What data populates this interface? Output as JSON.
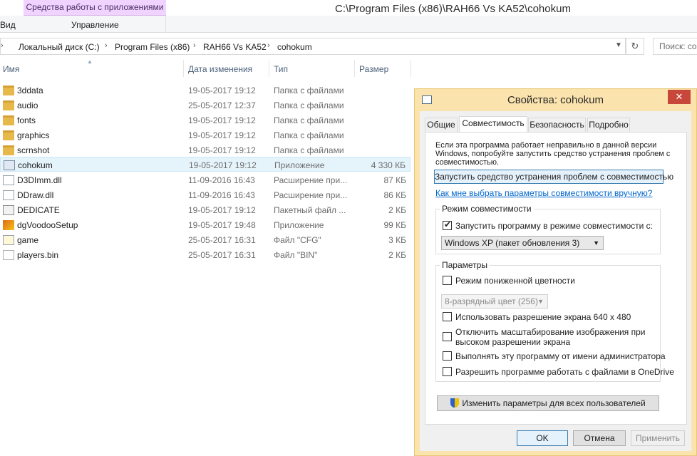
{
  "ribbon": {
    "context_tab": "Средства работы с приложениями",
    "view_tab": "Вид",
    "manage_tab": "Управление"
  },
  "window": {
    "title": "C:\\Program Files (x86)\\RAH66 Vs KA52\\cohokum"
  },
  "address": {
    "crumbs": [
      "Локальный диск (C:)",
      "Program Files (x86)",
      "RAH66 Vs KA52",
      "cohokum"
    ],
    "search_placeholder": "Поиск: co"
  },
  "columns": {
    "name": "Имя",
    "date": "Дата изменения",
    "type": "Тип",
    "size": "Размер"
  },
  "files": [
    {
      "name": "3ddata",
      "date": "19-05-2017 19:12",
      "type": "Папка с файлами",
      "size": "",
      "icon": "folder-icon"
    },
    {
      "name": "audio",
      "date": "25-05-2017 12:37",
      "type": "Папка с файлами",
      "size": "",
      "icon": "folder-icon"
    },
    {
      "name": "fonts",
      "date": "19-05-2017 19:12",
      "type": "Папка с файлами",
      "size": "",
      "icon": "folder-icon"
    },
    {
      "name": "graphics",
      "date": "19-05-2017 19:12",
      "type": "Папка с файлами",
      "size": "",
      "icon": "folder-icon"
    },
    {
      "name": "scrnshot",
      "date": "19-05-2017 19:12",
      "type": "Папка с файлами",
      "size": "",
      "icon": "folder-icon"
    },
    {
      "name": "cohokum",
      "date": "19-05-2017 19:12",
      "type": "Приложение",
      "size": "4 330 КБ",
      "icon": "exe-icon"
    },
    {
      "name": "D3DImm.dll",
      "date": "11-09-2016 16:43",
      "type": "Расширение при...",
      "size": "87 КБ",
      "icon": "dll-icon"
    },
    {
      "name": "DDraw.dll",
      "date": "11-09-2016 16:43",
      "type": "Расширение при...",
      "size": "86 КБ",
      "icon": "dll-icon"
    },
    {
      "name": "DEDICATE",
      "date": "19-05-2017 19:12",
      "type": "Пакетный файл ...",
      "size": "2 КБ",
      "icon": "batch-file-icon"
    },
    {
      "name": "dgVoodooSetup",
      "date": "19-05-2017 19:48",
      "type": "Приложение",
      "size": "99 КБ",
      "icon": "setup-app-icon"
    },
    {
      "name": "game",
      "date": "25-05-2017 16:31",
      "type": "Файл \"CFG\"",
      "size": "3 КБ",
      "icon": "config-file-icon"
    },
    {
      "name": "players.bin",
      "date": "25-05-2017 16:31",
      "type": "Файл \"BIN\"",
      "size": "2 КБ",
      "icon": "binary-file-icon"
    }
  ],
  "dialog": {
    "title": "Свойства: cohokum",
    "tabs": [
      "Общие",
      "Совместимость",
      "Безопасность",
      "Подробно"
    ],
    "intro": "Если эта программа работает неправильно в данной версии Windows, попробуйте запустить средство устранения проблем с совместимостью.",
    "troubleshoot_button": "Запустить средство устранения проблем с совместимостью",
    "manual_link": "Как мне выбрать параметры совместимости вручную?",
    "compat_group": "Режим совместимости",
    "compat_checkbox": "Запустить программу в режиме совместимости с:",
    "compat_os": "Windows XP (пакет обновления 3)",
    "params_group": "Параметры",
    "reduced_color": "Режим пониженной цветности",
    "color_mode": "8-разрядный цвет (256)",
    "res_640": "Использовать разрешение экрана 640 x 480",
    "dpi_line1": "Отключить масштабирование изображения при",
    "dpi_line2": "высоком разрешении экрана",
    "run_admin": "Выполнять эту программу от имени администратора",
    "onedrive": "Разрешить программе работать с файлами в OneDrive",
    "all_users_button": "Изменить параметры для всех пользователей",
    "ok": "OK",
    "cancel": "Отмена",
    "apply": "Применить"
  }
}
